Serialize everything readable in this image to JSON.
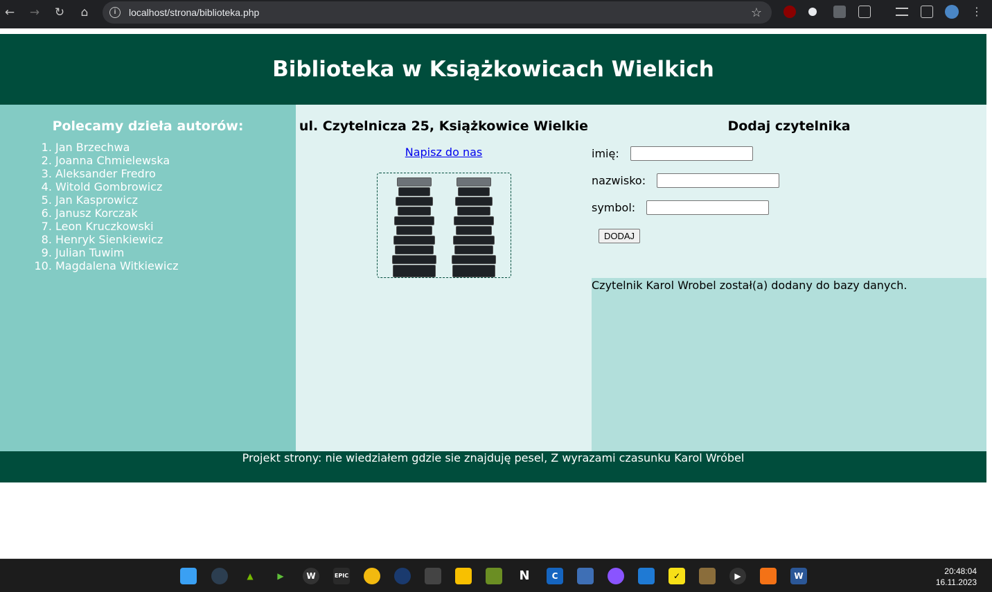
{
  "browser": {
    "url": "localhost/strona/biblioteka.php",
    "back_icon": "←",
    "forward_icon": "→",
    "reload_icon": "↻",
    "home_icon": "⌂",
    "star_icon": "☆"
  },
  "page": {
    "title": "Biblioteka w Książkowicach Wielkich",
    "left": {
      "heading": "Polecamy dzieła autorów:",
      "authors": [
        "Jan Brzechwa",
        "Joanna Chmielewska",
        "Aleksander Fredro",
        "Witold Gombrowicz",
        "Jan Kasprowicz",
        "Janusz Korczak",
        "Leon Kruczkowski",
        "Henryk Sienkiewicz",
        "Julian Tuwim",
        "Magdalena Witkiewicz"
      ]
    },
    "middle": {
      "address": "ul. Czytelnicza 25, Książkowice Wielkie",
      "contact_link": "Napisz do nas"
    },
    "form": {
      "heading": "Dodaj czytelnika",
      "imie_label": "imię:",
      "nazwisko_label": "nazwisko:",
      "symbol_label": "symbol:",
      "imie_value": "",
      "nazwisko_value": "",
      "symbol_value": "",
      "submit_label": "DODAJ"
    },
    "result_message": "Czytelnik Karol Wrobel został(a) dodany do bazy danych.",
    "footer": "Projekt strony: nie wiedziałem gdzie sie znajduję pesel, Z wyrazami czasunku Karol Wróbel"
  },
  "taskbar": {
    "time": "20:48:04",
    "date": "16.11.2023"
  },
  "colors": {
    "header": "#004d3c",
    "left_panel": "#83cbc4",
    "panel": "#e0f2f1",
    "result": "#b2dfdb"
  }
}
